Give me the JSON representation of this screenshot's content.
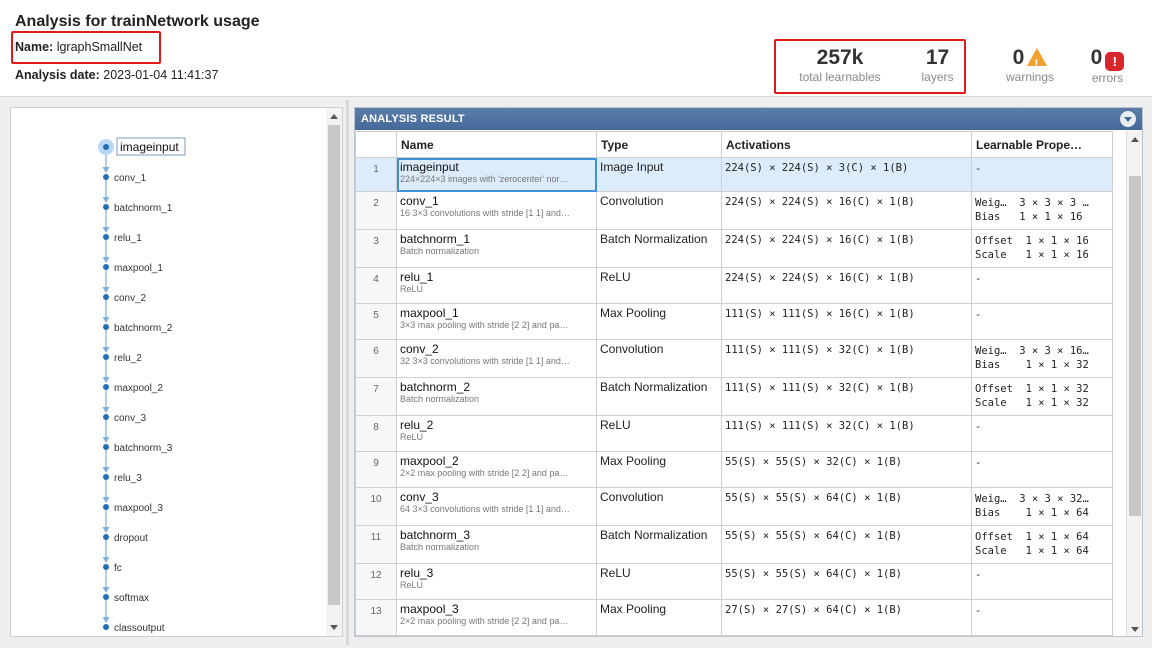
{
  "header": {
    "title": "Analysis for trainNetwork usage",
    "name_label": "Name:",
    "name_value": "lgraphSmallNet",
    "date_label": "Analysis date:",
    "date_value": "2023-01-04 11:41:37",
    "learnables_value": "257k",
    "learnables_caption": "total learnables",
    "layers_value": "17",
    "layers_caption": "layers",
    "warnings_value": "0",
    "warnings_caption": "warnings",
    "errors_value": "0",
    "errors_caption": "errors",
    "warning_icon": "warning-triangle-icon",
    "error_icon": "error-octagon-icon"
  },
  "graph": {
    "nodes": [
      "imageinput",
      "conv_1",
      "batchnorm_1",
      "relu_1",
      "maxpool_1",
      "conv_2",
      "batchnorm_2",
      "relu_2",
      "maxpool_2",
      "conv_3",
      "batchnorm_3",
      "relu_3",
      "maxpool_3",
      "dropout",
      "fc",
      "softmax",
      "classoutput"
    ],
    "selected": "imageinput",
    "node_color": "#1f6fb5",
    "edge_color": "#7fb1dd"
  },
  "result": {
    "title": "ANALYSIS RESULT",
    "columns": [
      "Name",
      "Type",
      "Activations",
      "Learnable Prope…"
    ],
    "rows": [
      {
        "idx": "1",
        "name": "imageinput",
        "desc": "224×224×3 images with 'zerocenter' nor…",
        "type": "Image Input",
        "act": "224(S) × 224(S) × 3(C) × 1(B)",
        "learn": [
          "-"
        ]
      },
      {
        "idx": "2",
        "name": "conv_1",
        "desc": "16 3×3 convolutions with stride [1 1] and…",
        "type": "Convolution",
        "act": "224(S) × 224(S) × 16(C) × 1(B)",
        "learn": [
          "Weig…  3 × 3 × 3 …",
          "Bias   1 × 1 × 16"
        ]
      },
      {
        "idx": "3",
        "name": "batchnorm_1",
        "desc": "Batch normalization",
        "type": "Batch Normalization",
        "act": "224(S) × 224(S) × 16(C) × 1(B)",
        "learn": [
          "Offset  1 × 1 × 16",
          "Scale   1 × 1 × 16"
        ]
      },
      {
        "idx": "4",
        "name": "relu_1",
        "desc": "ReLU",
        "type": "ReLU",
        "act": "224(S) × 224(S) × 16(C) × 1(B)",
        "learn": [
          "-"
        ]
      },
      {
        "idx": "5",
        "name": "maxpool_1",
        "desc": "3×3 max pooling with stride [2 2] and pa…",
        "type": "Max Pooling",
        "act": "111(S) × 111(S) × 16(C) × 1(B)",
        "learn": [
          "-"
        ]
      },
      {
        "idx": "6",
        "name": "conv_2",
        "desc": "32 3×3 convolutions with stride [1 1] and…",
        "type": "Convolution",
        "act": "111(S) × 111(S) × 32(C) × 1(B)",
        "learn": [
          "Weig…  3 × 3 × 16…",
          "Bias    1 × 1 × 32"
        ]
      },
      {
        "idx": "7",
        "name": "batchnorm_2",
        "desc": "Batch normalization",
        "type": "Batch Normalization",
        "act": "111(S) × 111(S) × 32(C) × 1(B)",
        "learn": [
          "Offset  1 × 1 × 32",
          "Scale   1 × 1 × 32"
        ]
      },
      {
        "idx": "8",
        "name": "relu_2",
        "desc": "ReLU",
        "type": "ReLU",
        "act": "111(S) × 111(S) × 32(C) × 1(B)",
        "learn": [
          "-"
        ]
      },
      {
        "idx": "9",
        "name": "maxpool_2",
        "desc": "2×2 max pooling with stride [2 2] and pa…",
        "type": "Max Pooling",
        "act": "55(S) × 55(S) × 32(C) × 1(B)",
        "learn": [
          "-"
        ]
      },
      {
        "idx": "10",
        "name": "conv_3",
        "desc": "64 3×3 convolutions with stride [1 1] and…",
        "type": "Convolution",
        "act": "55(S) × 55(S) × 64(C) × 1(B)",
        "learn": [
          "Weig…  3 × 3 × 32…",
          "Bias    1 × 1 × 64"
        ]
      },
      {
        "idx": "11",
        "name": "batchnorm_3",
        "desc": "Batch normalization",
        "type": "Batch Normalization",
        "act": "55(S) × 55(S) × 64(C) × 1(B)",
        "learn": [
          "Offset  1 × 1 × 64",
          "Scale   1 × 1 × 64"
        ]
      },
      {
        "idx": "12",
        "name": "relu_3",
        "desc": "ReLU",
        "type": "ReLU",
        "act": "55(S) × 55(S) × 64(C) × 1(B)",
        "learn": [
          "-"
        ]
      },
      {
        "idx": "13",
        "name": "maxpool_3",
        "desc": "2×2 max pooling with stride [2 2] and pa…",
        "type": "Max Pooling",
        "act": "27(S) × 27(S) × 64(C) × 1(B)",
        "learn": [
          "-"
        ]
      }
    ]
  }
}
